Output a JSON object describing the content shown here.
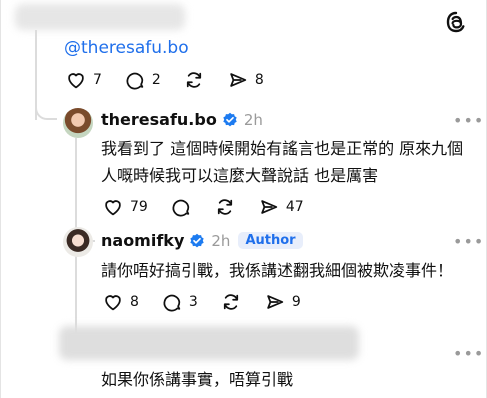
{
  "app": {
    "logo": "threads-icon"
  },
  "top_post": {
    "handle_mention": "@theresafu.bo",
    "likes": "7",
    "replies": "2",
    "shares": "8"
  },
  "reply1": {
    "username": "theresafu.bo",
    "time": "2h",
    "text_line1": "我看到了 這個時候開始有謠言也是正常的 原來九個",
    "text_line2": "人嘅時候我可以這麼大聲說話 也是厲害",
    "likes": "79",
    "shares": "47",
    "more": "•••"
  },
  "reply2": {
    "username": "naomifky",
    "time": "2h",
    "badge": "Author",
    "text": "請你唔好搞引戰，我係講述翻我細個被欺凌事件！",
    "likes": "8",
    "replies": "3",
    "shares": "9",
    "more": "•••"
  },
  "reply3": {
    "text": "如果你係講事實，唔算引戰",
    "more": "•••"
  },
  "colors": {
    "accent": "#1f6feb",
    "verified": "#1d7bf0",
    "muted": "#9a9a9a"
  }
}
